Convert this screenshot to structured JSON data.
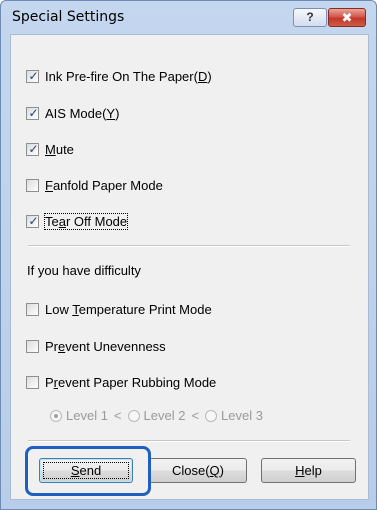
{
  "window": {
    "title": "Special Settings",
    "help_glyph": "?",
    "close_glyph": "✖"
  },
  "options": [
    {
      "label_pre": "Ink Pre-fire On The Paper(",
      "accel": "D",
      "label_post": ")",
      "checked": true
    },
    {
      "label_pre": "AIS Mode(",
      "accel": "Y",
      "label_post": ")",
      "checked": true
    },
    {
      "label_pre": "",
      "accel": "M",
      "label_post": "ute",
      "checked": true
    },
    {
      "label_pre": "",
      "accel": "F",
      "label_post": "anfold Paper Mode",
      "checked": false
    },
    {
      "label_pre": "Te",
      "accel": "a",
      "label_post": "r Off Mode",
      "checked": true
    }
  ],
  "difficulty": {
    "heading": "If you have difficulty",
    "options": [
      {
        "label_pre": "Low ",
        "accel": "T",
        "label_post": "emperature Print Mode",
        "checked": false
      },
      {
        "label_pre": "Pr",
        "accel": "e",
        "label_post": "vent Unevenness",
        "checked": false
      },
      {
        "label_pre": "P",
        "accel": "r",
        "label_post": "event Paper Rubbing Mode",
        "checked": false
      }
    ],
    "levels": {
      "level1": "Level 1",
      "level2": "Level 2",
      "level3": "Level 3",
      "separator": "<",
      "selected": "Level 1"
    }
  },
  "buttons": {
    "send_accel": "S",
    "send_rest": "end",
    "close_pre": "Close(",
    "close_accel": "Q",
    "close_post": ")",
    "help_accel": "H",
    "help_rest": "elp"
  },
  "check_glyph": "✓"
}
